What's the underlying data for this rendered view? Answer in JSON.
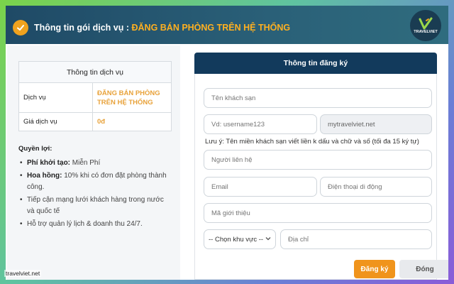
{
  "header": {
    "title_prefix": "Thông tin gói dịch vụ : ",
    "title_highlight": "ĐĂNG BÁN PHÒNG TRÊN HỆ THỐNG",
    "brand": "TRAVELVIET",
    "accent_color": "#f0a21e",
    "header_color": "#1f4a66"
  },
  "service_table": {
    "heading": "Thông tin dịch vụ",
    "rows": [
      {
        "label": "Dịch vụ",
        "value": "ĐĂNG BÁN PHÒNG TRÊN HỆ THỐNG"
      },
      {
        "label": "Giá dịch vụ",
        "value": "0đ"
      }
    ]
  },
  "benefits": {
    "title": "Quyền lợi:",
    "items": [
      {
        "bold": "Phí khởi tạo:",
        "text": " Miễn Phí"
      },
      {
        "bold": "Hoa hồng:",
        "text": " 10% khi có đơn đặt phòng thành công."
      },
      {
        "bold": "",
        "text": "Tiếp cận mạng lưới khách hàng trong nước và quốc tế"
      },
      {
        "bold": "",
        "text": "Hỗ trợ quản lý lịch & doanh thu 24/7."
      }
    ]
  },
  "registration": {
    "heading": "Thông tin đăng ký",
    "hotel_name_placeholder": "Tên khách sạn",
    "username_placeholder": "Vd: username123",
    "domain_suffix": "mytravelviet.net",
    "note": "Lưu ý: Tên miền khách sạn viết liền k dấu và chữ và số (tối đa 15 ký tự)",
    "contact_placeholder": "Người liên hệ",
    "email_placeholder": "Email",
    "phone_placeholder": "Điện thoại di động",
    "referral_placeholder": "Mã giới thiệu",
    "region_selected": "-- Chọn khu vực --",
    "address_placeholder": "Địa chỉ"
  },
  "buttons": {
    "register": "Đăng ký",
    "close": "Đóng"
  },
  "watermark": "travelviet.net"
}
